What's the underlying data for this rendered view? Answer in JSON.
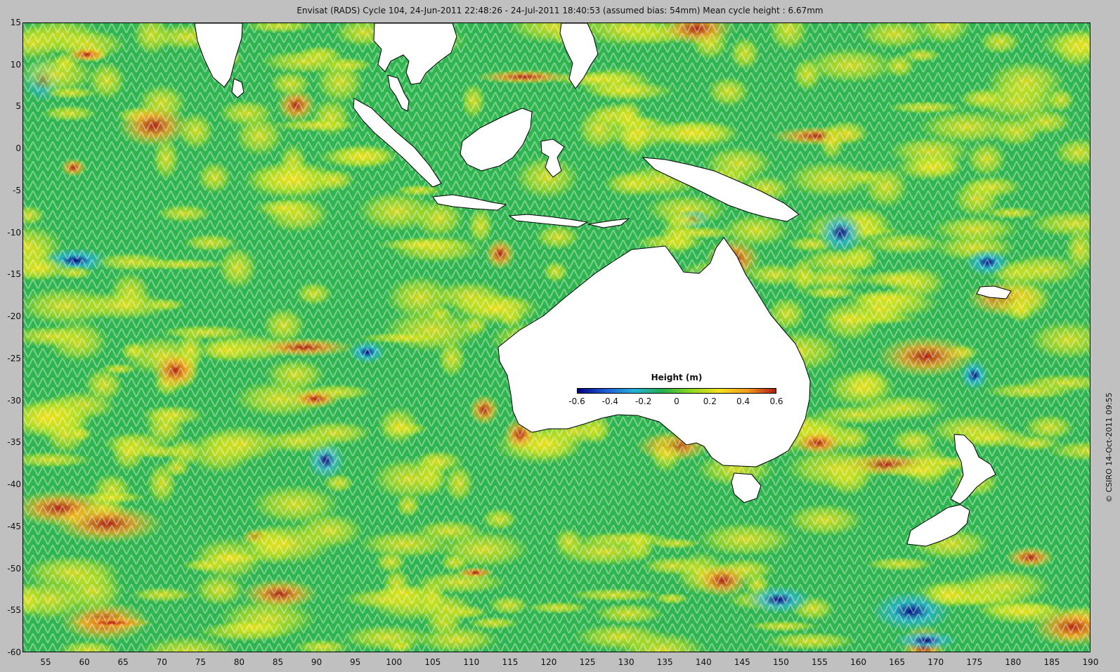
{
  "title": "Envisat (RADS) Cycle 104, 24-Jun-2011 22:48:26 - 24-Jul-2011 18:40:53 (assumed bias: 54mm)  Mean cycle height : 6.67mm",
  "map": {
    "projection": "plate carrée",
    "lon_range": [
      52,
      190
    ],
    "lat_range": [
      -60,
      15
    ],
    "x_ticks": [
      "55",
      "60",
      "65",
      "70",
      "75",
      "80",
      "85",
      "90",
      "95",
      "100",
      "105",
      "110",
      "115",
      "120",
      "125",
      "130",
      "135",
      "140",
      "145",
      "150",
      "155",
      "160",
      "165",
      "170",
      "175",
      "180",
      "185",
      "190"
    ],
    "y_ticks": [
      "15",
      "10",
      "5",
      "0",
      "-5",
      "-10",
      "-15",
      "-20",
      "-25",
      "-30",
      "-35",
      "-40",
      "-45",
      "-50",
      "-55",
      "-60"
    ],
    "field": "sea surface height anomaly",
    "land_color": "#ffffff",
    "coast_color": "#000000"
  },
  "legend": {
    "title": "Height (m)",
    "ticks": [
      "-0.6",
      "-0.4",
      "-0.2",
      "0",
      "0.2",
      "0.4",
      "0.6"
    ],
    "colors": [
      "#000080",
      "#1e5bd6",
      "#23b2d6",
      "#22b04b",
      "#8ed81f",
      "#f5e11b",
      "#f29b1f",
      "#b31b0f"
    ]
  },
  "copyright": "© CSIRO 14-Oct-2011 09:55"
}
